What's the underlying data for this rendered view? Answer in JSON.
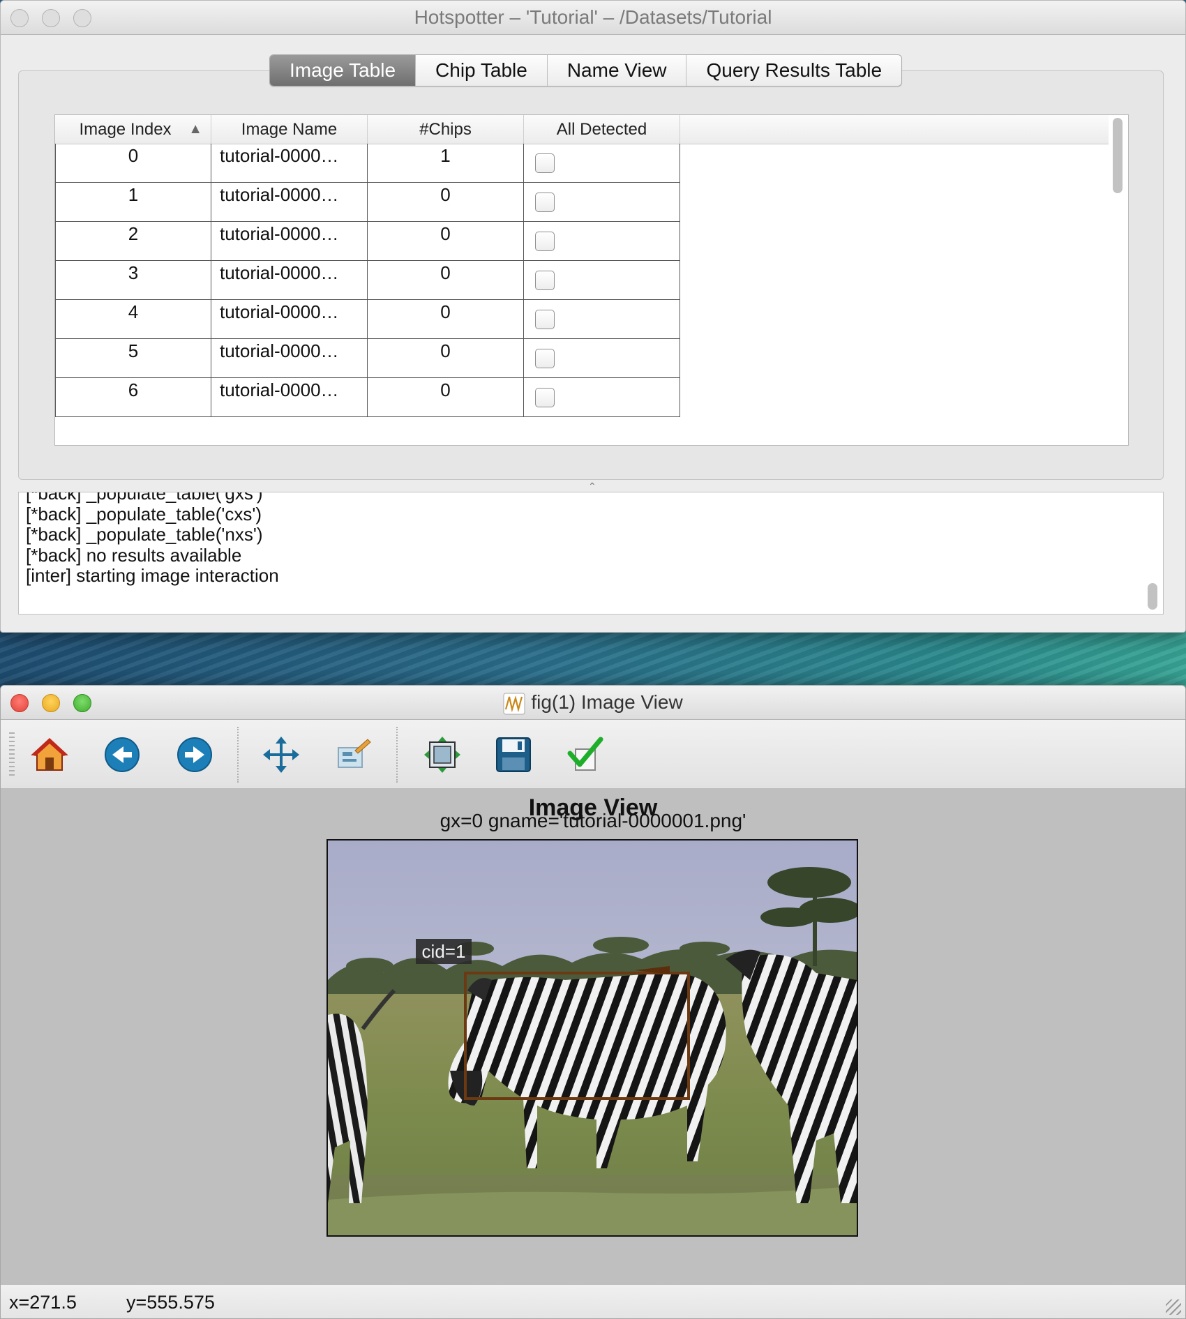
{
  "main_window": {
    "title": "Hotspotter – 'Tutorial' – /Datasets/Tutorial",
    "tabs": [
      {
        "label": "Image Table",
        "active": true
      },
      {
        "label": "Chip Table",
        "active": false
      },
      {
        "label": "Name View",
        "active": false
      },
      {
        "label": "Query Results Table",
        "active": false
      }
    ],
    "table": {
      "columns": [
        "Image Index",
        "Image Name",
        "#Chips",
        "All Detected"
      ],
      "sort_indicator": "▲",
      "rows": [
        {
          "index": "0",
          "name": "tutorial-0000…",
          "chips": "1",
          "all_detected": false
        },
        {
          "index": "1",
          "name": "tutorial-0000…",
          "chips": "0",
          "all_detected": false
        },
        {
          "index": "2",
          "name": "tutorial-0000…",
          "chips": "0",
          "all_detected": false
        },
        {
          "index": "3",
          "name": "tutorial-0000…",
          "chips": "0",
          "all_detected": false
        },
        {
          "index": "4",
          "name": "tutorial-0000…",
          "chips": "0",
          "all_detected": false
        },
        {
          "index": "5",
          "name": "tutorial-0000…",
          "chips": "0",
          "all_detected": false
        },
        {
          "index": "6",
          "name": "tutorial-0000…",
          "chips": "0",
          "all_detected": false
        }
      ]
    },
    "console_lines": [
      "[*back] _populate_table('gxs')",
      "[*back] _populate_table('cxs')",
      "[*back] _populate_table('nxs')",
      "[*back] no results available",
      "[inter] starting image interaction"
    ]
  },
  "figure_window": {
    "title": "fig(1) Image View",
    "toolbar_icons": [
      "home-icon",
      "back-icon",
      "forward-icon",
      "pan-icon",
      "zoom-icon",
      "configure-subplots-icon",
      "save-icon",
      "edit-icon"
    ],
    "plot_title": "Image View",
    "plot_subtitle": "gx=0 gname='tutorial-0000001.png'",
    "chip_label": "cid=1",
    "status_x": "x=271.5",
    "status_y": "y=555.575"
  },
  "colors": {
    "active_tab": "#7f7f7f",
    "chip_box": "#6b3a12",
    "figure_bg": "#bfbfbf"
  }
}
